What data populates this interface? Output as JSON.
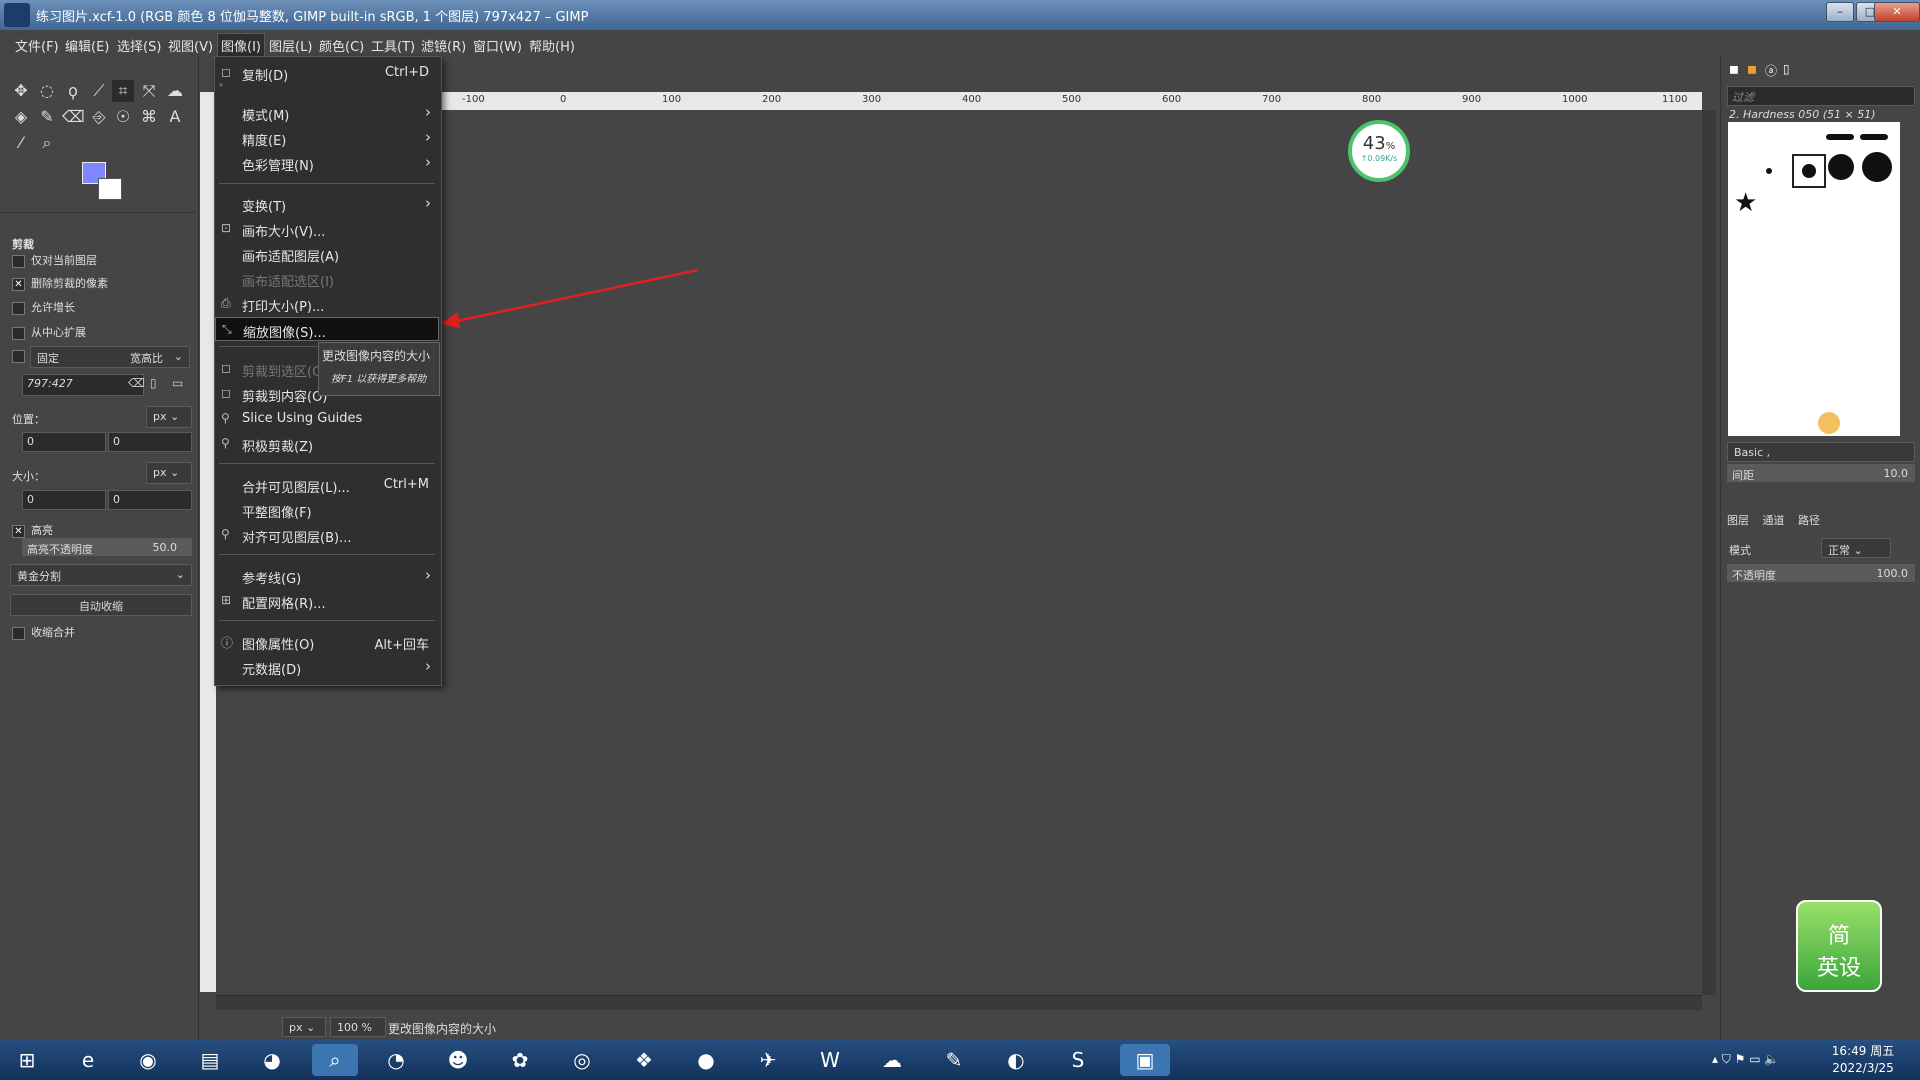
{
  "window": {
    "title": "练习图片.xcf-1.0 (RGB 颜色 8 位伽马整数, GIMP built-in sRGB, 1 个图层) 797x427 – GIMP",
    "min": "–",
    "max": "□",
    "close": "✕"
  },
  "menubar": [
    "文件(F)",
    "编辑(E)",
    "选择(S)",
    "视图(V)",
    "图像(I)",
    "图层(L)",
    "颜色(C)",
    "工具(T)",
    "滤镜(R)",
    "窗口(W)",
    "帮助(H)"
  ],
  "image_menu": {
    "items": [
      {
        "label": "复制(D)",
        "shortcut": "Ctrl+D"
      },
      {
        "label": "模式(M)"
      },
      {
        "label": "精度(E)"
      },
      {
        "label": "色彩管理(N)"
      },
      {
        "label": "变换(T)"
      },
      {
        "label": "画布大小(V)..."
      },
      {
        "label": "画布适配图层(A)"
      },
      {
        "label": "画布适配选区(I)"
      },
      {
        "label": "打印大小(P)..."
      },
      {
        "label": "缩放图像(S)..."
      },
      {
        "label": "剪裁到选区(C)"
      },
      {
        "label": "剪裁到内容(O)"
      },
      {
        "label": "Slice Using Guides"
      },
      {
        "label": "积极剪裁(Z)"
      },
      {
        "label": "合并可见图层(L)...",
        "shortcut": "Ctrl+M"
      },
      {
        "label": "平整图像(F)"
      },
      {
        "label": "对齐可见图层(B)..."
      },
      {
        "label": "参考线(G)"
      },
      {
        "label": "配置网格(R)..."
      },
      {
        "label": "图像属性(O)",
        "shortcut": "Alt+回车"
      },
      {
        "label": "元数据(D)"
      }
    ]
  },
  "tooltip": {
    "line1": "更改图像内容的大小",
    "line2": "按F1 以获得更多帮助"
  },
  "tool_options": {
    "title": "剪裁",
    "current_layer_only": "仅对当前图层",
    "delete_cropped": "删除剪裁的像素",
    "allow_grow": "允许增长",
    "expand_center": "从中心扩展",
    "fixed": "固定",
    "aspect": "宽高比",
    "ratio_value": "797:427",
    "position_label": "位置：",
    "size_label": "大小：",
    "unit": "px",
    "pos_x": "0",
    "pos_y": "0",
    "size_x": "0",
    "size_y": "0",
    "highlight": "高亮",
    "highlight_opacity_label": "高亮不透明度",
    "highlight_opacity_value": "50.0",
    "guides": "黄金分割",
    "auto_shrink": "自动收缩",
    "shrink_merged": "收缩合并"
  },
  "ruler": [
    "-100",
    "0",
    "100",
    "200",
    "300",
    "400",
    "500",
    "600",
    "700",
    "800",
    "900",
    "1000",
    "1100"
  ],
  "net_widget": {
    "percent": "43",
    "unit": "%",
    "speed": "↑0.09K/s"
  },
  "right_dock": {
    "filter_placeholder": "过滤",
    "brush_name": "2. Hardness 050 (51 × 51)",
    "brush_set": "Basic ,",
    "spacing_label": "间距",
    "spacing_value": "10.0",
    "tabs": [
      "图层",
      "通道",
      "路径"
    ],
    "mode_label": "模式",
    "mode_value": "正常",
    "opacity_label": "不透明度",
    "opacity_value": "100.0"
  },
  "status": {
    "unit": "px",
    "zoom": "100 %",
    "message": "更改图像内容的大小"
  },
  "app_badge": {
    "line1": "简",
    "line2": "英设"
  },
  "clock": {
    "time": "16:49 周五",
    "date": "2022/3/25"
  }
}
